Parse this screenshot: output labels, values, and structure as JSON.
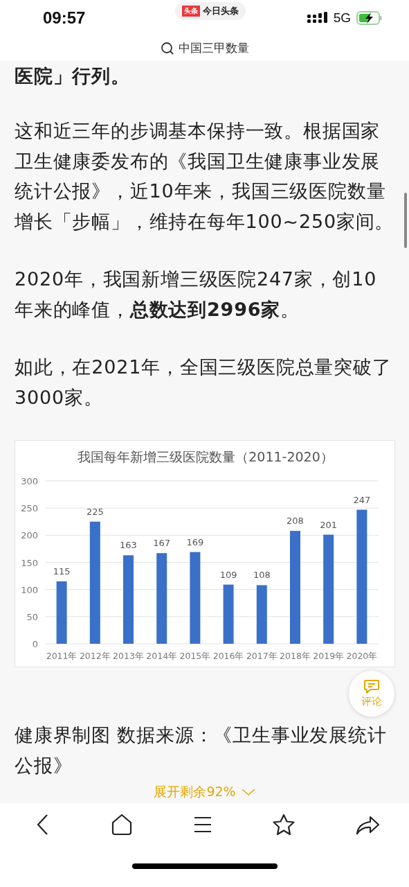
{
  "status_bar": {
    "time": "09:57",
    "app_badge": "头条",
    "app_name": "今日头条",
    "network": "5G"
  },
  "search": {
    "query": "中国三甲数量"
  },
  "article": {
    "paragraphs": [
      {
        "text": "医院」行列。",
        "bold": true
      },
      {
        "text": "这和近三年的步调基本保持一致。根据国家卫生健康委发布的《我国卫生健康事业发展统计公报》，近10年来，我国三级医院数量增长「步幅」，维持在每年100~250家间。",
        "bold": false
      },
      {
        "text": "2020年，我国新增三级医院247家，创10年来的峰值，**总数达到2996家**。",
        "bold": false
      },
      {
        "text": "如此，在2021年，全国三级医院总量突破了3000家。",
        "bold": false
      }
    ],
    "chart_data": {
      "type": "bar",
      "title": "我国每年新增三级医院数量（2011-2020）",
      "categories": [
        "2011年",
        "2012年",
        "2013年",
        "2014年",
        "2015年",
        "2016年",
        "2017年",
        "2018年",
        "2019年",
        "2020年"
      ],
      "values": [
        115,
        225,
        163,
        167,
        169,
        109,
        108,
        208,
        201,
        247
      ],
      "ylim": [
        0,
        300
      ],
      "yticks": [
        0,
        50,
        100,
        150,
        200,
        250,
        300
      ],
      "grid": true,
      "data_labels": true
    },
    "caption": "健康界制图 数据来源：《卫生事业发展统计公报》",
    "expand": "展开剩余92%"
  },
  "comment_button": {
    "label": "评论"
  }
}
